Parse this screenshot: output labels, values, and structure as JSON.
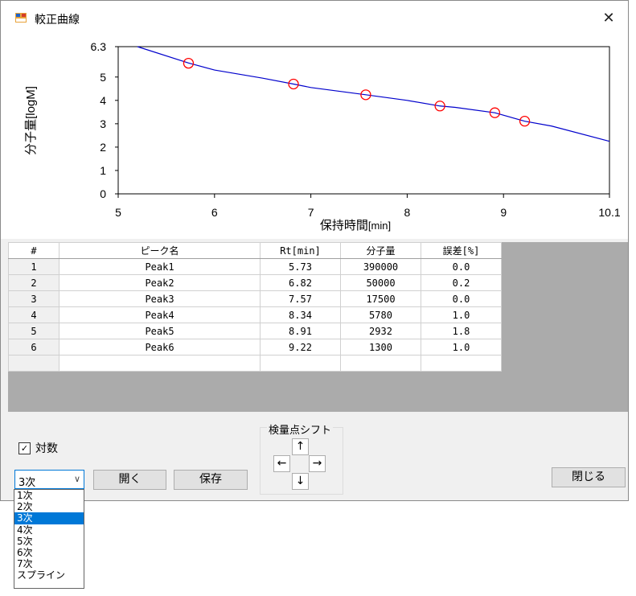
{
  "window": {
    "title": "較正曲線",
    "close_symbol": "✕"
  },
  "chart_data": {
    "type": "line",
    "ylabel": "分子量[logM]",
    "xlabel_main": "保持時間",
    "xlabel_unit": "[min]",
    "xlim": [
      5,
      10.1
    ],
    "ylim": [
      0,
      6.3
    ],
    "x_ticks": [
      "5",
      "6",
      "7",
      "8",
      "9",
      "10.1"
    ],
    "y_ticks": [
      "0",
      "1",
      "2",
      "3",
      "4",
      "5",
      "6.3"
    ],
    "curve": {
      "x": [
        5.2,
        5.73,
        6.0,
        6.5,
        6.82,
        7.0,
        7.57,
        8.0,
        8.34,
        8.5,
        8.91,
        9.22,
        9.5,
        10.1
      ],
      "y": [
        6.3,
        5.6,
        5.3,
        4.95,
        4.7,
        4.55,
        4.24,
        4.0,
        3.76,
        3.7,
        3.47,
        3.11,
        2.9,
        2.25
      ],
      "color": "#0000cc"
    },
    "points": {
      "x": [
        5.73,
        6.82,
        7.57,
        8.34,
        8.91,
        9.22
      ],
      "y": [
        5.59,
        4.7,
        4.24,
        3.76,
        3.47,
        3.11
      ],
      "color": "#ff0000"
    }
  },
  "table": {
    "headers": [
      "#",
      "ピーク名",
      "Rt[min]",
      "分子量",
      "誤差[%]"
    ],
    "rows": [
      [
        "1",
        "Peak1",
        "5.73",
        "390000",
        "0.0"
      ],
      [
        "2",
        "Peak2",
        "6.82",
        "50000",
        "0.2"
      ],
      [
        "3",
        "Peak3",
        "7.57",
        "17500",
        "0.0"
      ],
      [
        "4",
        "Peak4",
        "8.34",
        "5780",
        "1.0"
      ],
      [
        "5",
        "Peak5",
        "8.91",
        "2932",
        "1.8"
      ],
      [
        "6",
        "Peak6",
        "9.22",
        "1300",
        "1.0"
      ]
    ]
  },
  "controls": {
    "log_checkbox_label": "対数",
    "log_checked": true,
    "check_mark": "✓",
    "combo_value": "3次",
    "combo_arrow": "∨",
    "open_button": "開く",
    "save_button": "保存",
    "close_button": "閉じる",
    "shift_group_label": "検量点シフト",
    "arrow_up": "↑",
    "arrow_down": "↓",
    "arrow_left": "←",
    "arrow_right": "→"
  },
  "dropdown": {
    "options": [
      "1次",
      "2次",
      "3次",
      "4次",
      "5次",
      "6次",
      "7次",
      "スプライン"
    ],
    "selected_index": 2
  }
}
